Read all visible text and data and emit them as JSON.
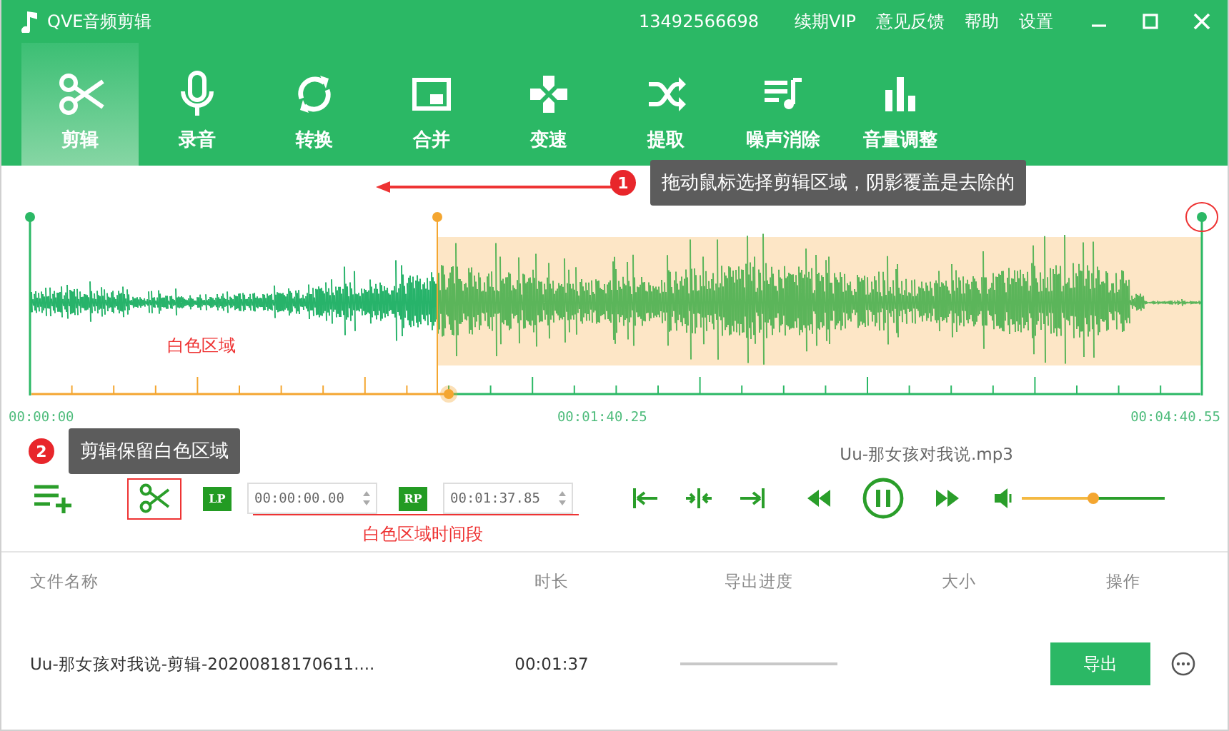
{
  "window": {
    "title": "QVE音频剪辑",
    "account": "13492566698",
    "links": [
      "续期VIP",
      "意见反馈",
      "帮助",
      "设置"
    ]
  },
  "tabs": [
    {
      "label": "剪辑",
      "selected": true
    },
    {
      "label": "录音",
      "selected": false
    },
    {
      "label": "转换",
      "selected": false
    },
    {
      "label": "合并",
      "selected": false
    },
    {
      "label": "变速",
      "selected": false
    },
    {
      "label": "提取",
      "selected": false
    },
    {
      "label": "噪声消除",
      "selected": false
    },
    {
      "label": "音量调整",
      "selected": false
    }
  ],
  "editor": {
    "region_label": "白色区域",
    "time_start": "00:00:00",
    "time_mid": "00:01:40.25",
    "time_end": "00:04:40.55",
    "file_name": "Uu-那女孩对我说.mp3",
    "lp_label": "LP",
    "lp_value": "00:00:00.00",
    "rp_label": "RP",
    "rp_value": "00:01:37.85",
    "range_label": "白色区域时间段",
    "playing": true,
    "volume": {
      "level": 0.5
    }
  },
  "annotations": [
    {
      "number": "1",
      "text": "拖动鼠标选择剪辑区域，阴影覆盖是去除的"
    },
    {
      "number": "2",
      "text": "剪辑保留白色区域"
    }
  ],
  "table": {
    "columns": [
      "文件名称",
      "时长",
      "导出进度",
      "大小",
      "操作"
    ],
    "rows": [
      {
        "name": "Uu-那女孩对我说-剪辑-20200818170611....",
        "duration": "00:01:37",
        "action": "导出",
        "level": 0
      }
    ]
  }
}
